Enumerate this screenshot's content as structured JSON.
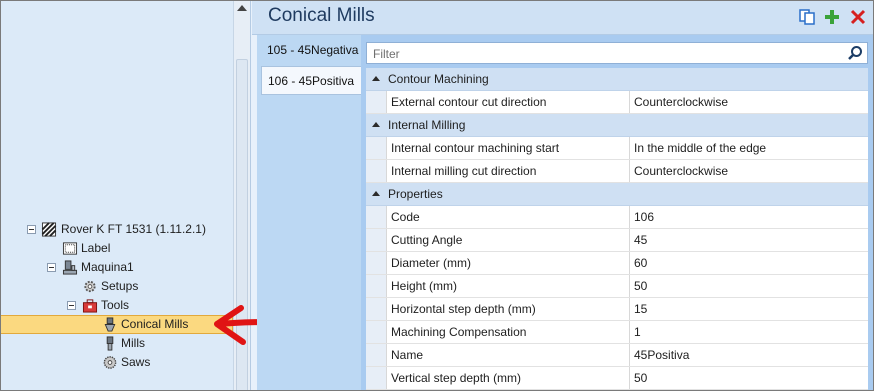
{
  "window": {
    "title": "Conical Mills"
  },
  "header_actions": [
    {
      "name": "copy-icon",
      "color": "#2a6fc9"
    },
    {
      "name": "add-icon",
      "color": "#3aa33a"
    },
    {
      "name": "delete-icon",
      "color": "#d62020"
    }
  ],
  "tree": {
    "root": "Rover K FT 1531 (1.11.2.1)",
    "label": "Label",
    "machine": "Maquina1",
    "setups": "Setups",
    "tools": "Tools",
    "conical_mills": "Conical Mills",
    "mills": "Mills",
    "saws": "Saws"
  },
  "tabs": [
    {
      "label": "105 - 45Negativa",
      "active": false
    },
    {
      "label": "106 - 45Positiva",
      "active": true
    }
  ],
  "filter": {
    "placeholder": "Filter"
  },
  "categories": {
    "contour": "Contour Machining",
    "internal": "Internal Milling",
    "properties": "Properties"
  },
  "rows": {
    "ext_cut_dir": {
      "key": "External contour cut direction",
      "value": "Counterclockwise"
    },
    "int_start": {
      "key": "Internal contour machining start",
      "value": "In the middle of the edge"
    },
    "int_cut_dir": {
      "key": "Internal milling cut direction",
      "value": "Counterclockwise"
    },
    "code": {
      "key": "Code",
      "value": "106"
    },
    "cutting_angle": {
      "key": "Cutting Angle",
      "value": "45"
    },
    "diameter": {
      "key": "Diameter (mm)",
      "value": "60"
    },
    "height": {
      "key": "Height (mm)",
      "value": "50"
    },
    "h_step": {
      "key": "Horizontal step depth (mm)",
      "value": "15"
    },
    "mach_comp": {
      "key": "Machining Compensation",
      "value": "1"
    },
    "name": {
      "key": "Name",
      "value": "45Positiva"
    },
    "v_step": {
      "key": "Vertical step depth (mm)",
      "value": "50"
    }
  },
  "colors": {
    "selection": "#fbd980",
    "arrow": "#e01414",
    "accent": "#1e3a5f"
  }
}
